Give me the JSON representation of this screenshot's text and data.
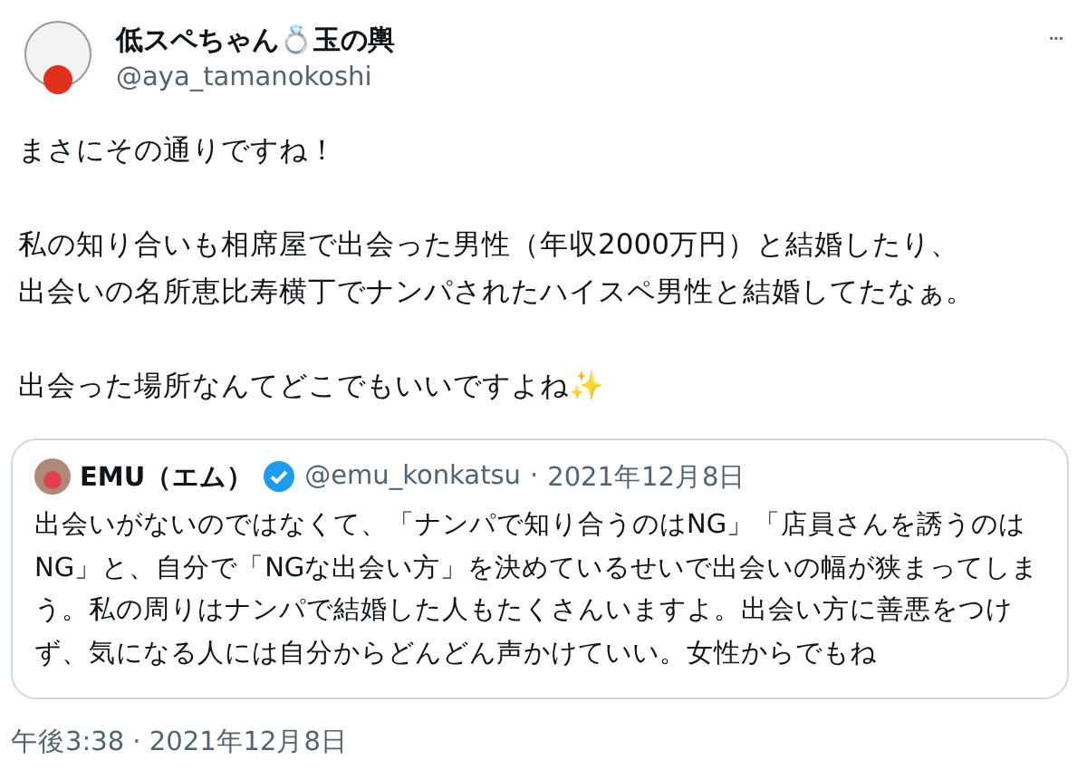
{
  "author": {
    "name": "低スペちゃん💍玉の輿",
    "handle": "@aya_tamanokoshi"
  },
  "more_menu": "···",
  "paragraphs": [
    [
      "まさにその通りですね！"
    ],
    [
      "私の知り合いも相席屋で出会った男性（年収2000万円）と結婚したり、",
      "出会いの名所恵比寿横丁でナンパされたハイスペ男性と結婚してたなぁ。"
    ],
    [
      "出会った場所なんてどこでもいいですよね✨"
    ]
  ],
  "quoted_tweet": {
    "name": "EMU（エム）",
    "verified": true,
    "handle": "@emu_konkatsu",
    "separator": "·",
    "date": "2021年12月8日",
    "text": "出会いがないのではなくて、「ナンパで知り合うのはNG」「店員さんを誘うのはNG」と、自分で「NGな出会い方」を決めているせいで出会いの幅が狭まってしまう。私の周りはナンパで結婚した人もたくさんいますよ。出会い方に善悪をつけず、気になる人には自分からどんどん声かけていい。女性からでもね"
  },
  "timestamp": "午後3:38 · 2021年12月8日"
}
